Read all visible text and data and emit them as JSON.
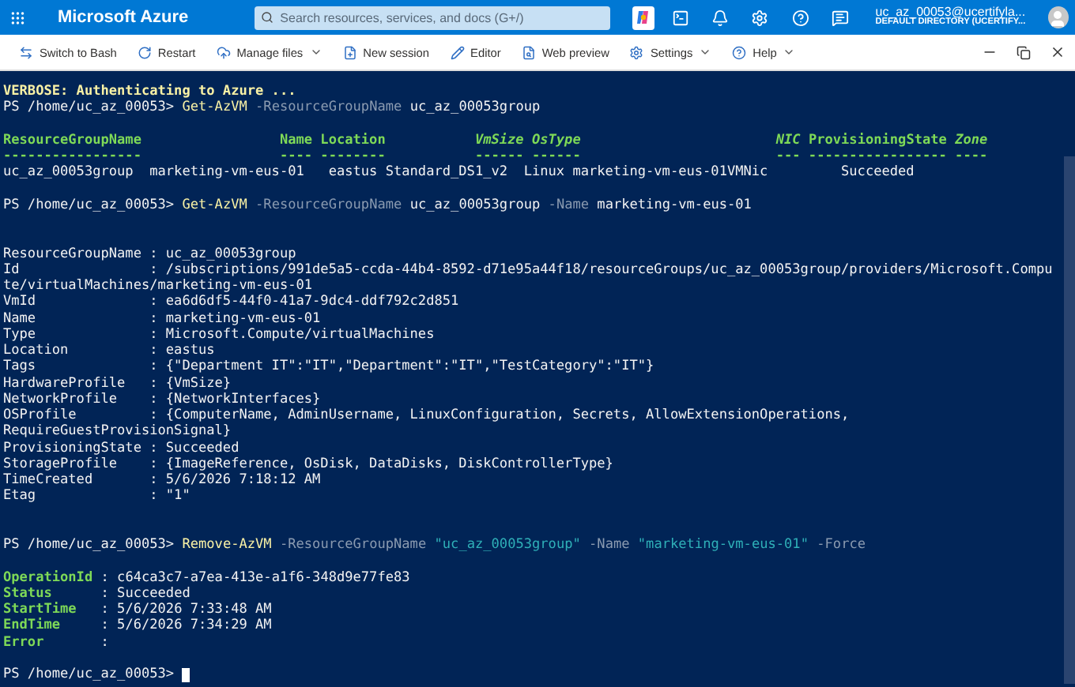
{
  "top_bar": {
    "brand": "Microsoft Azure",
    "search": {
      "placeholder": "Search resources, services, and docs (G+/)"
    },
    "account": {
      "email": "uc_az_00053@ucertifyla...",
      "directory": "DEFAULT DIRECTORY (UCERTIFY..."
    }
  },
  "toolbar": {
    "items": [
      {
        "kind": "switch",
        "label": "Switch to Bash",
        "dropdown": false
      },
      {
        "kind": "restart",
        "label": "Restart",
        "dropdown": false
      },
      {
        "kind": "files",
        "label": "Manage files",
        "dropdown": true
      },
      {
        "kind": "session",
        "label": "New session",
        "dropdown": false
      },
      {
        "kind": "editor",
        "label": "Editor",
        "dropdown": false
      },
      {
        "kind": "preview",
        "label": "Web preview",
        "dropdown": false
      },
      {
        "kind": "settings",
        "label": "Settings",
        "dropdown": true
      },
      {
        "kind": "help",
        "label": "Help",
        "dropdown": true
      }
    ]
  },
  "terminal": {
    "cursor": true,
    "lines": [
      {
        "segments": [
          {
            "kind": "verbose",
            "text": "VERBOSE: Authenticating to Azure ..."
          }
        ]
      },
      {
        "segments": [
          {
            "kind": "plain",
            "text": "PS /home/uc_az_00053> "
          },
          {
            "kind": "command",
            "text": "Get-AzVM"
          },
          {
            "kind": "param",
            "text": " -ResourceGroupName"
          },
          {
            "kind": "plain",
            "text": " uc_az_00053group"
          }
        ]
      },
      {
        "kind": "blank"
      },
      {
        "segments": [
          {
            "kind": "header",
            "text": "ResourceGroupName                 Name Location           "
          },
          {
            "kind": "header-italic",
            "text": "VmSize OsType                       "
          },
          {
            "kind": "header-italic",
            "text": " NIC"
          },
          {
            "kind": "header",
            "text": " ProvisioningState"
          },
          {
            "kind": "header-italic",
            "text": " Zone"
          }
        ]
      },
      {
        "segments": [
          {
            "kind": "header",
            "text": "-----------------                 ---- --------           ------ ------                        --- ----------------- ----"
          }
        ]
      },
      {
        "segments": [
          {
            "kind": "plain",
            "text": "uc_az_00053group  marketing-vm-eus-01   eastus Standard_DS1_v2  Linux marketing-vm-eus-01VMNic         Succeeded"
          }
        ]
      },
      {
        "kind": "blank"
      },
      {
        "segments": [
          {
            "kind": "plain",
            "text": "PS /home/uc_az_00053> "
          },
          {
            "kind": "command",
            "text": "Get-AzVM"
          },
          {
            "kind": "param",
            "text": " -ResourceGroupName"
          },
          {
            "kind": "plain",
            "text": " uc_az_00053group"
          },
          {
            "kind": "param",
            "text": " -Name"
          },
          {
            "kind": "plain",
            "text": " marketing-vm-eus-01"
          }
        ]
      },
      {
        "kind": "blank"
      },
      {
        "kind": "blank"
      },
      {
        "segments": [
          {
            "kind": "plain",
            "text": "ResourceGroupName : uc_az_00053group"
          }
        ]
      },
      {
        "segments": [
          {
            "kind": "plain",
            "text": "Id                : /subscriptions/991de5a5-ccda-44b4-8592-d71e95a44f18/resourceGroups/uc_az_00053group/providers/Microsoft.Compu"
          }
        ]
      },
      {
        "segments": [
          {
            "kind": "plain",
            "text": "te/virtualMachines/marketing-vm-eus-01"
          }
        ]
      },
      {
        "segments": [
          {
            "kind": "plain",
            "text": "VmId              : ea6d6df5-44f0-41a7-9dc4-ddf792c2d851"
          }
        ]
      },
      {
        "segments": [
          {
            "kind": "plain",
            "text": "Name              : marketing-vm-eus-01"
          }
        ]
      },
      {
        "segments": [
          {
            "kind": "plain",
            "text": "Type              : Microsoft.Compute/virtualMachines"
          }
        ]
      },
      {
        "segments": [
          {
            "kind": "plain",
            "text": "Location          : eastus"
          }
        ]
      },
      {
        "segments": [
          {
            "kind": "plain",
            "text": "Tags              : {\"Department IT\":\"IT\",\"Department\":\"IT\",\"TestCategory\":\"IT\"}"
          }
        ]
      },
      {
        "segments": [
          {
            "kind": "plain",
            "text": "HardwareProfile   : {VmSize}"
          }
        ]
      },
      {
        "segments": [
          {
            "kind": "plain",
            "text": "NetworkProfile    : {NetworkInterfaces}"
          }
        ]
      },
      {
        "segments": [
          {
            "kind": "plain",
            "text": "OSProfile         : {ComputerName, AdminUsername, LinuxConfiguration, Secrets, AllowExtensionOperations,"
          }
        ]
      },
      {
        "segments": [
          {
            "kind": "plain",
            "text": "RequireGuestProvisionSignal}"
          }
        ]
      },
      {
        "segments": [
          {
            "kind": "plain",
            "text": "ProvisioningState : Succeeded"
          }
        ]
      },
      {
        "segments": [
          {
            "kind": "plain",
            "text": "StorageProfile    : {ImageReference, OsDisk, DataDisks, DiskControllerType}"
          }
        ]
      },
      {
        "segments": [
          {
            "kind": "plain",
            "text": "TimeCreated       : 5/6/2026 7:18:12 AM"
          }
        ]
      },
      {
        "segments": [
          {
            "kind": "plain",
            "text": "Etag              : \"1\""
          }
        ]
      },
      {
        "kind": "blank"
      },
      {
        "kind": "blank"
      },
      {
        "segments": [
          {
            "kind": "plain",
            "text": "PS /home/uc_az_00053> "
          },
          {
            "kind": "command",
            "text": "Remove-AzVM"
          },
          {
            "kind": "param",
            "text": " -ResourceGroupName"
          },
          {
            "kind": "string",
            "text": " \"uc_az_00053group\""
          },
          {
            "kind": "param",
            "text": " -Name"
          },
          {
            "kind": "string",
            "text": " \"marketing-vm-eus-01\""
          },
          {
            "kind": "param",
            "text": " -Force"
          }
        ]
      },
      {
        "kind": "blank"
      },
      {
        "segments": [
          {
            "kind": "label",
            "text": "OperationId"
          },
          {
            "kind": "plain",
            "text": " : c64ca3c7-a7ea-413e-a1f6-348d9e77fe83"
          }
        ]
      },
      {
        "segments": [
          {
            "kind": "label",
            "text": "Status     "
          },
          {
            "kind": "plain",
            "text": " : Succeeded"
          }
        ]
      },
      {
        "segments": [
          {
            "kind": "label",
            "text": "StartTime  "
          },
          {
            "kind": "plain",
            "text": " : 5/6/2026 7:33:48 AM"
          }
        ]
      },
      {
        "segments": [
          {
            "kind": "label",
            "text": "EndTime    "
          },
          {
            "kind": "plain",
            "text": " : 5/6/2026 7:34:29 AM"
          }
        ]
      },
      {
        "segments": [
          {
            "kind": "label",
            "text": "Error      "
          },
          {
            "kind": "plain",
            "text": " :"
          }
        ]
      },
      {
        "kind": "blank"
      },
      {
        "segments": [
          {
            "kind": "plain",
            "text": "PS /home/uc_az_00053> "
          }
        ]
      }
    ]
  }
}
